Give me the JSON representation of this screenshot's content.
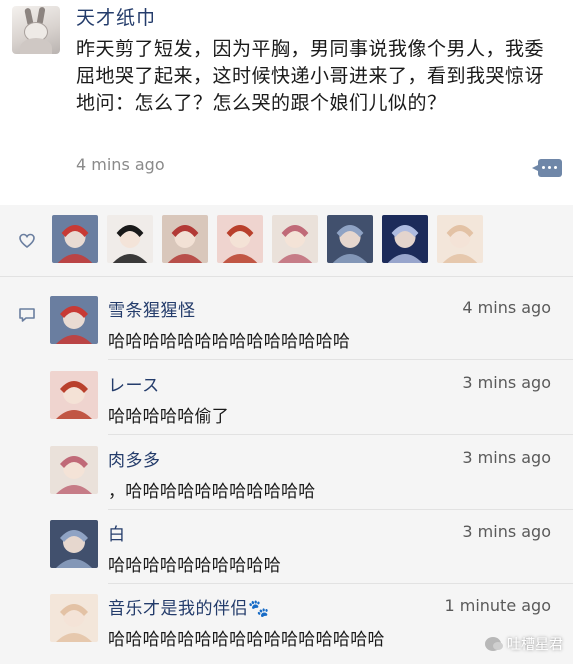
{
  "post": {
    "author": "天才纸巾",
    "text": "昨天剪了短发，因为平胸，男同事说我像个男人，我委屈地哭了起来，这时候快递小哥进来了，看到我哭惊讶地问：怎么了？怎么哭的跟个娘们儿似的？",
    "time": "4 mins ago"
  },
  "likes": {
    "avatars": [
      {
        "name": "like-avatar-1",
        "bg": "#6a7ea0",
        "accent": "#c83a35"
      },
      {
        "name": "like-avatar-2",
        "bg": "#f0ece9",
        "accent": "#1a1a1a"
      },
      {
        "name": "like-avatar-3",
        "bg": "#d9c7bb",
        "accent": "#b23a36"
      },
      {
        "name": "like-avatar-4",
        "bg": "#efd4cf",
        "accent": "#b9402c"
      },
      {
        "name": "like-avatar-5",
        "bg": "#eae1da",
        "accent": "#c06a78"
      },
      {
        "name": "like-avatar-6",
        "bg": "#41506d",
        "accent": "#8fa3c4"
      },
      {
        "name": "like-avatar-7",
        "bg": "#1c2b5a",
        "accent": "#aebbe0"
      },
      {
        "name": "like-avatar-8",
        "bg": "#f3e6da",
        "accent": "#e3c2a5"
      }
    ]
  },
  "comments": [
    {
      "name": "雪条猩猩怪",
      "time": "4 mins ago",
      "text": "哈哈哈哈哈哈哈哈哈哈哈哈哈哈",
      "bg": "#6a7ea0",
      "accent": "#c83a35"
    },
    {
      "name": "レース",
      "time": "3 mins ago",
      "text": "哈哈哈哈哈偷了",
      "bg": "#efd4cf",
      "accent": "#b9402c"
    },
    {
      "name": "肉多多",
      "time": "3 mins ago",
      "text": "，哈哈哈哈哈哈哈哈哈哈哈",
      "bg": "#eae1da",
      "accent": "#c06a78"
    },
    {
      "name": "白",
      "time": "3 mins ago",
      "text": "哈哈哈哈哈哈哈哈哈哈",
      "bg": "#41506d",
      "accent": "#8fa3c4"
    },
    {
      "name": "音乐才是我的伴侣🐾",
      "time": "1 minute ago",
      "text": "哈哈哈哈哈哈哈哈哈哈哈哈哈哈哈哈",
      "bg": "#f3e6da",
      "accent": "#e3c2a5"
    }
  ],
  "watermark": {
    "text": "吐槽星君"
  }
}
